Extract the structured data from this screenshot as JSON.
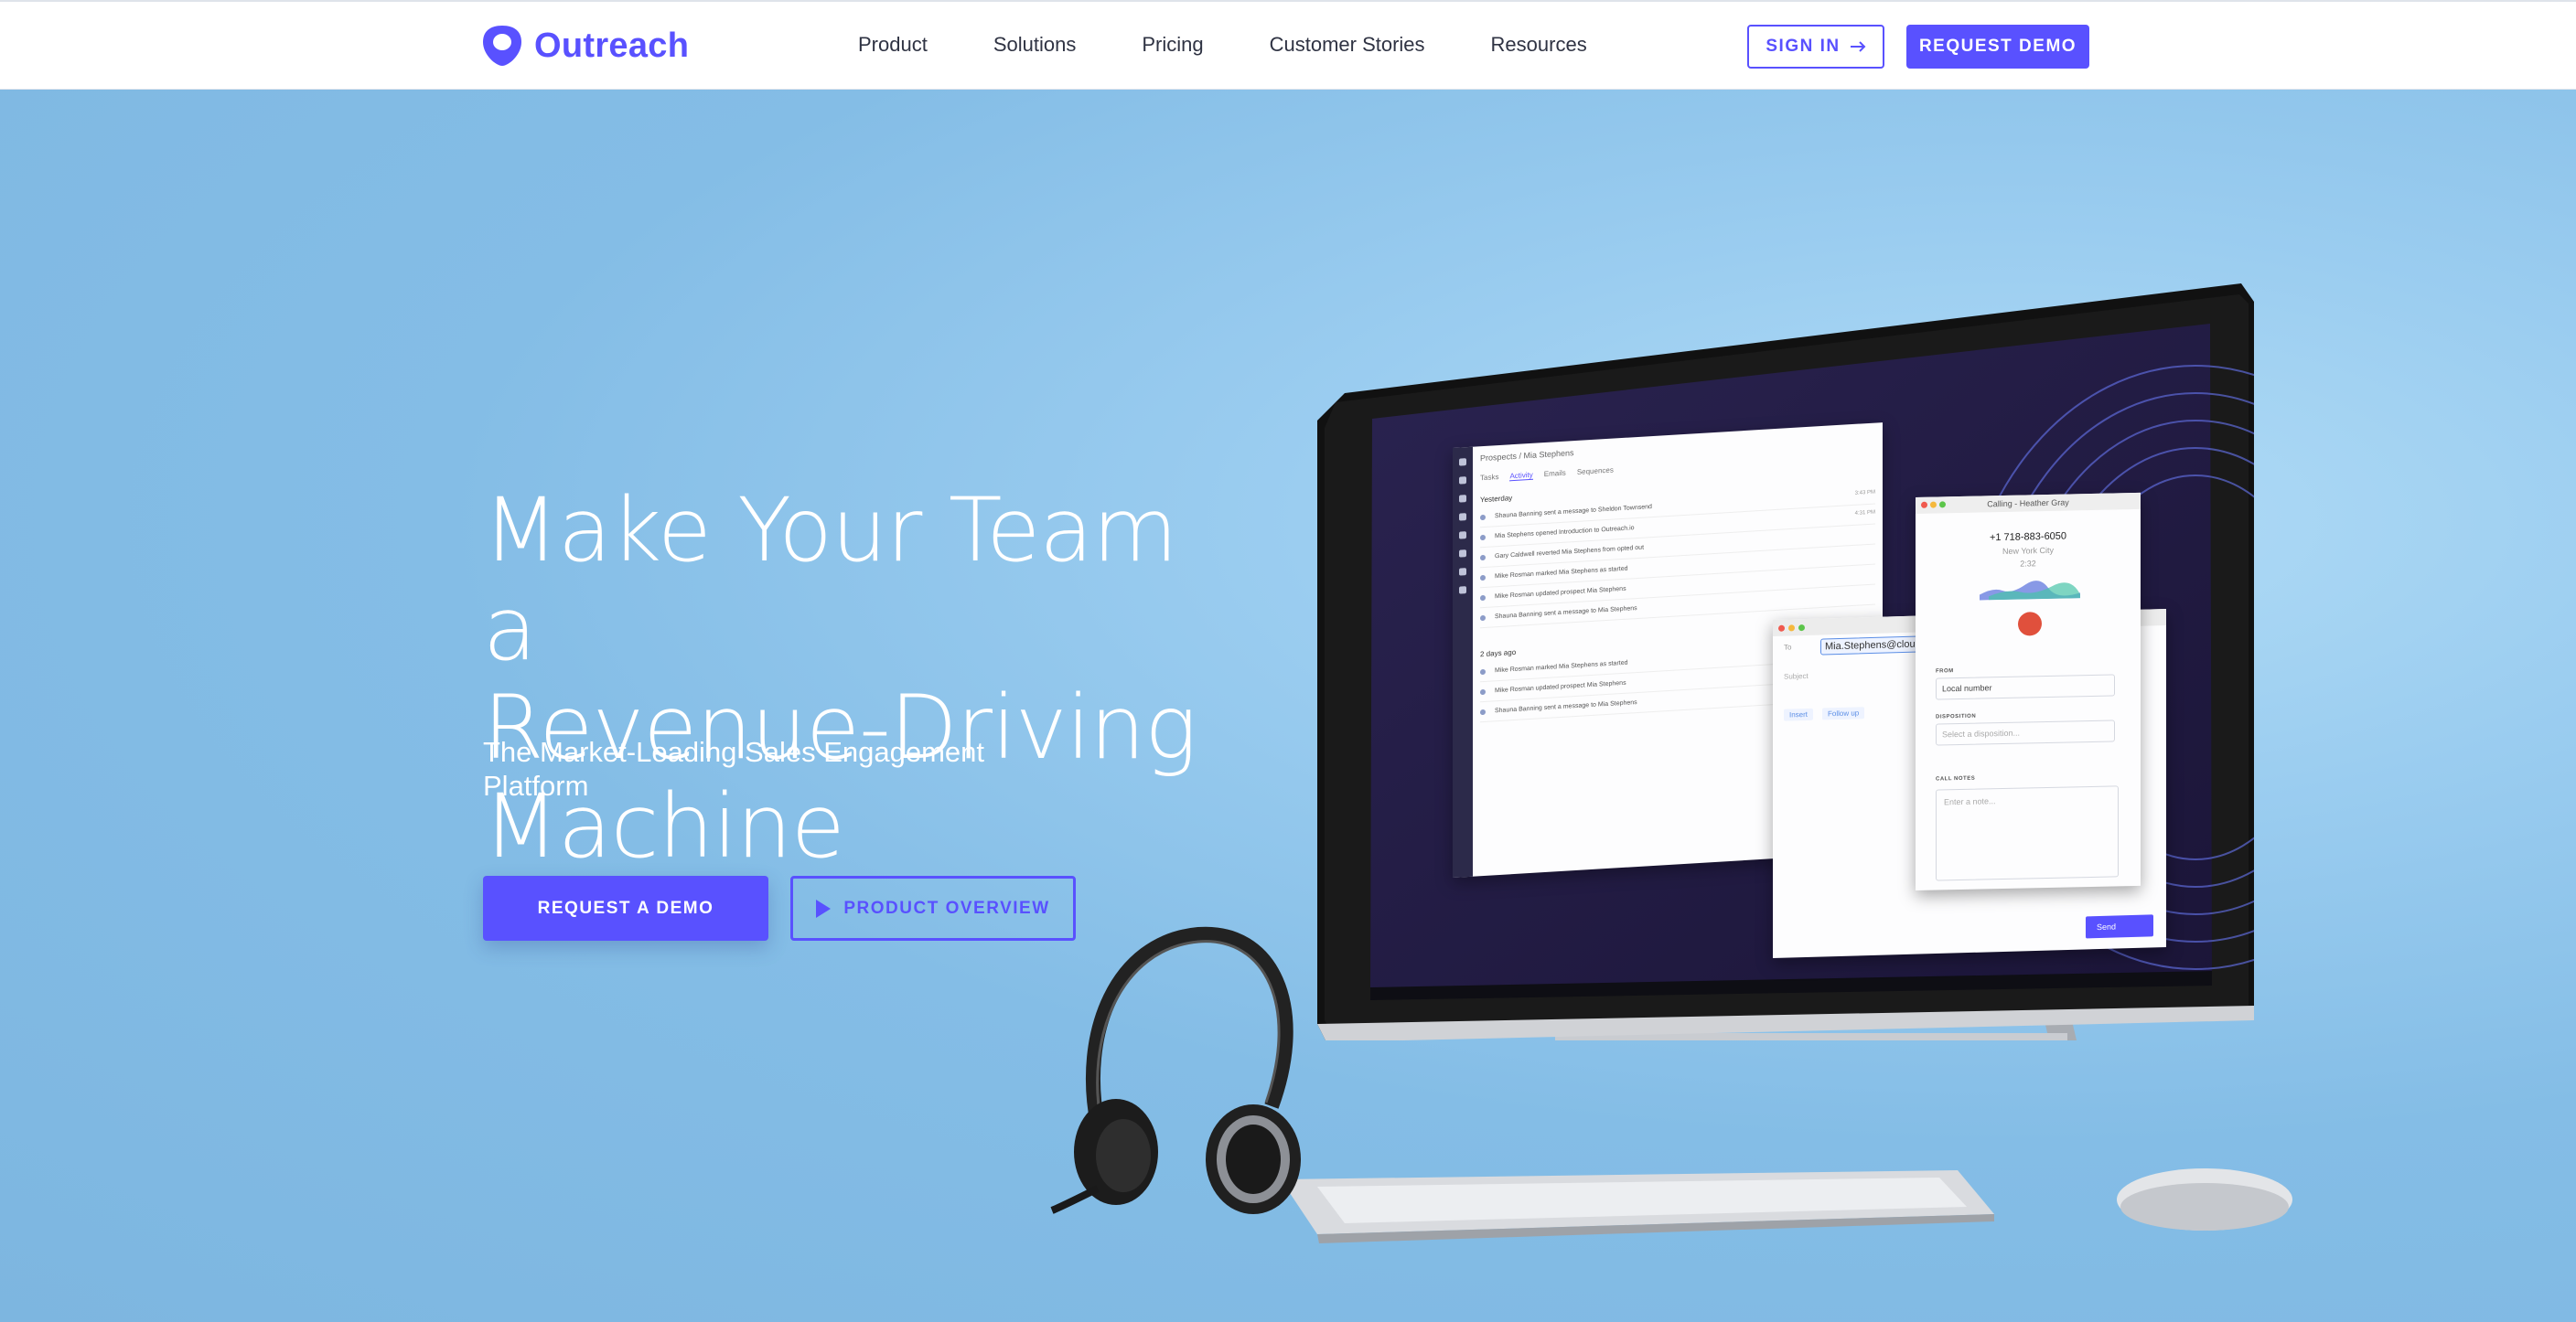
{
  "brand": {
    "name": "Outreach",
    "accent": "#5951ff"
  },
  "nav": {
    "links": [
      "Product",
      "Solutions",
      "Pricing",
      "Customer Stories",
      "Resources"
    ],
    "sign_in": "SIGN IN",
    "request_demo": "REQUEST DEMO"
  },
  "hero": {
    "title_lines": [
      "Make Your Team a",
      "Revenue-Driving",
      "Machine"
    ],
    "subtitle": "The Market-Leading Sales Engagement Platform",
    "cta_primary": "REQUEST A DEMO",
    "cta_secondary": "PRODUCT OVERVIEW"
  },
  "screen": {
    "crm": {
      "breadcrumb": "Prospects  /  Mia Stephens",
      "tabs": [
        "Tasks",
        "Activity",
        "Emails",
        "Sequences"
      ],
      "day_1": "Yesterday",
      "rows_day_1": [
        {
          "text": "Shauna Banning sent a message to Sheldon Townsend",
          "time": "3:43 PM"
        },
        {
          "text": "Mia Stephens opened Introduction to Outreach.io",
          "time": "4:31 PM"
        },
        {
          "text": "Gary Caldwell reverted Mia Stephens from opted out",
          "time": ""
        },
        {
          "text": "Mike Rosman marked Mia Stephens as started",
          "time": ""
        },
        {
          "text": "Mike Rosman updated prospect Mia Stephens",
          "time": ""
        },
        {
          "text": "Shauna Banning sent a message to Mia Stephens",
          "time": ""
        }
      ],
      "day_2": "2 days ago",
      "rows_day_2": [
        {
          "text": "Mike Rosman marked Mia Stephens as started",
          "time": ""
        },
        {
          "text": "Mike Rosman updated prospect Mia Stephens",
          "time": ""
        },
        {
          "text": "Shauna Banning sent a message to Mia Stephens",
          "time": ""
        }
      ]
    },
    "email": {
      "to_label": "To",
      "to_value": "Mia.Stephens@cloud",
      "subject_placeholder": "Subject",
      "insert": "Insert",
      "follow_up": "Follow up",
      "send": "Send"
    },
    "call": {
      "title": "Calling - Heather Gray",
      "number": "+1 718-883-6050",
      "location": "New York City",
      "duration": "2:32",
      "from_label": "FROM",
      "from_value": "Local number",
      "disposition_label": "DISPOSITION",
      "disposition_placeholder": "Select a disposition...",
      "notes_label": "CALL NOTES",
      "notes_placeholder": "Enter a note..."
    }
  }
}
